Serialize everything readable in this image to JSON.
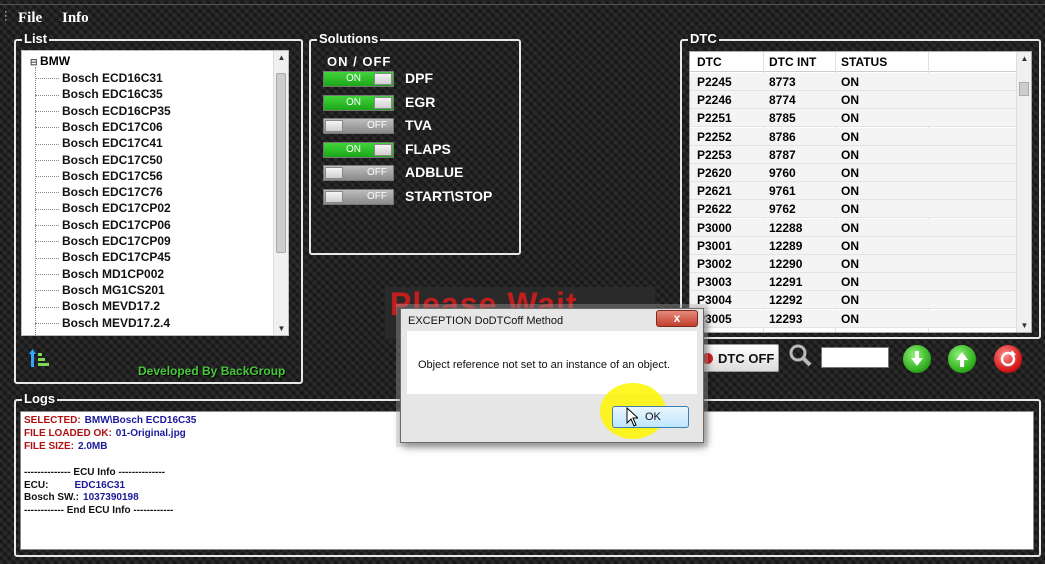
{
  "menu": {
    "file": "File",
    "info": "Info"
  },
  "list": {
    "title": "List",
    "root": "BMW",
    "items": [
      "Bosch ECD16C31",
      "Bosch EDC16C35",
      "Bosch ECD16CP35",
      "Bosch EDC17C06",
      "Bosch EDC17C41",
      "Bosch EDC17C50",
      "Bosch EDC17C56",
      "Bosch EDC17C76",
      "Bosch EDC17CP02",
      "Bosch EDC17CP06",
      "Bosch EDC17CP09",
      "Bosch EDC17CP45",
      "Bosch MD1CP002",
      "Bosch MG1CS201",
      "Bosch MEVD17.2",
      "Bosch MEVD17.2.4"
    ],
    "developed_by": "Developed By BackGroup"
  },
  "solutions": {
    "title": "Solutions",
    "header": "ON  /  OFF",
    "items": [
      {
        "label": "DPF",
        "state": "ON"
      },
      {
        "label": "EGR",
        "state": "ON"
      },
      {
        "label": "TVA",
        "state": "OFF"
      },
      {
        "label": "FLAPS",
        "state": "ON"
      },
      {
        "label": "ADBLUE",
        "state": "OFF"
      },
      {
        "label": "START\\STOP",
        "state": "OFF"
      }
    ]
  },
  "dtc": {
    "title": "DTC",
    "columns": [
      "DTC",
      "DTC INT",
      "STATUS"
    ],
    "rows": [
      [
        "P2245",
        "8773",
        "ON"
      ],
      [
        "P2246",
        "8774",
        "ON"
      ],
      [
        "P2251",
        "8785",
        "ON"
      ],
      [
        "P2252",
        "8786",
        "ON"
      ],
      [
        "P2253",
        "8787",
        "ON"
      ],
      [
        "P2620",
        "9760",
        "ON"
      ],
      [
        "P2621",
        "9761",
        "ON"
      ],
      [
        "P2622",
        "9762",
        "ON"
      ],
      [
        "P3000",
        "12288",
        "ON"
      ],
      [
        "P3001",
        "12289",
        "ON"
      ],
      [
        "P3002",
        "12290",
        "ON"
      ],
      [
        "P3003",
        "12291",
        "ON"
      ],
      [
        "P3004",
        "12292",
        "ON"
      ],
      [
        "P3005",
        "12293",
        "ON"
      ]
    ],
    "off_button": "DTC OFF",
    "search_value": ""
  },
  "overlay_text": "Please Wait",
  "logs": {
    "title": "Logs",
    "lines": [
      {
        "text": "SELECTED:",
        "value": "BMW\\Bosch ECD16C35"
      },
      {
        "text": "FILE LOADED OK:",
        "value": "01-Original.jpg"
      },
      {
        "text": "FILE SIZE:",
        "value": "2.0MB"
      },
      {
        "text": "",
        "value": ""
      },
      {
        "text": "-------------- ECU Info --------------",
        "value": ""
      },
      {
        "text": "ECU:",
        "value": "EDC16C31"
      },
      {
        "text": "Bosch SW.:",
        "value": "1037390198"
      },
      {
        "text": "------------ End ECU Info ------------",
        "value": ""
      }
    ]
  },
  "dialog": {
    "title": "EXCEPTION DoDTCoff Method",
    "close": "x",
    "message": "Object reference not set to an instance of an object.",
    "ok": "OK"
  },
  "colors": {
    "accent_green": "#3fd53a",
    "error_red": "#d42020",
    "dev_text": "#46c93a"
  }
}
